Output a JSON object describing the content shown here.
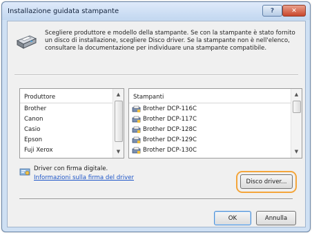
{
  "window": {
    "title": "Installazione guidata stampante",
    "help_label": "?",
    "close_label": "✕"
  },
  "description": "Scegliere produttore e modello della stampante. Se con la stampante è stato fornito un disco di installazione, scegliere Disco driver. Se la stampante non è nell'elenco, consultare la documentazione per individuare una stampante compatibile.",
  "manufacturers": {
    "header": "Produttore",
    "items": [
      "Brother",
      "Canon",
      "Casio",
      "Epson",
      "Fuji Xerox"
    ]
  },
  "printers": {
    "header": "Stampanti",
    "items": [
      "Brother DCP-116C",
      "Brother DCP-117C",
      "Brother DCP-128C",
      "Brother DCP-129C",
      "Brother DCP-130C"
    ]
  },
  "signature": {
    "label": "Driver con firma digitale.",
    "link": "Informazioni sulla firma del driver"
  },
  "buttons": {
    "disk": "Disco driver...",
    "ok": "OK",
    "cancel": "Annulla"
  },
  "colors": {
    "highlight": "#f4a53a",
    "link": "#1e56c8",
    "close_button": "#c9462c"
  }
}
